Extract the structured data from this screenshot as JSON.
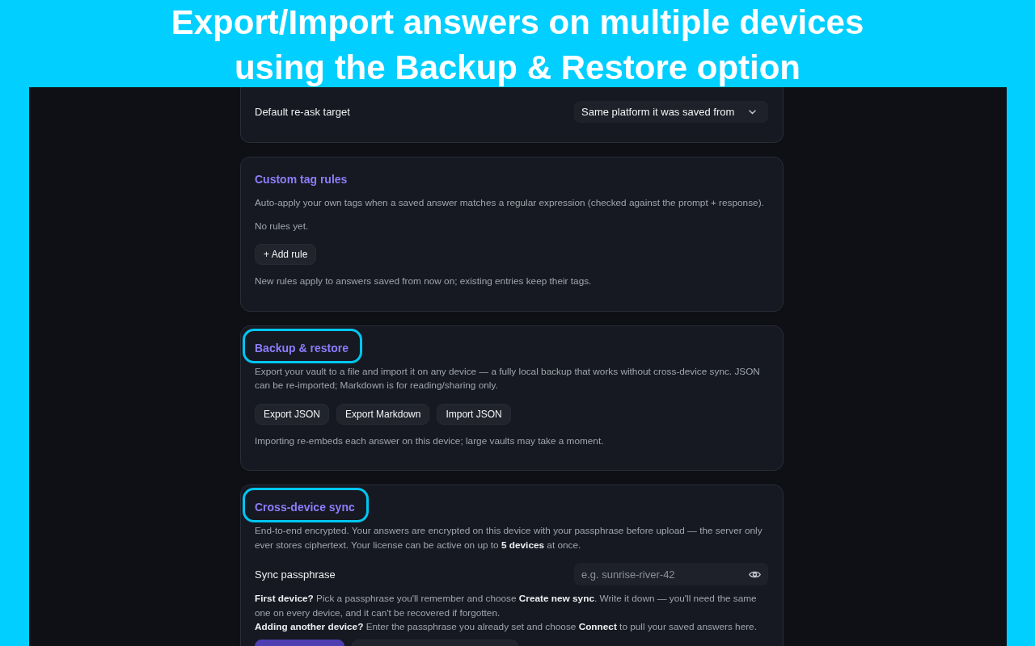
{
  "banner": {
    "lines": [
      "Export/Import answers on multiple devices",
      "using the Backup & Restore option"
    ]
  },
  "cards": [
    {
      "blocks": [
        {
          "kind": "select_row",
          "label": "Default re-ask target",
          "value": "Same platform it was saved from"
        }
      ]
    },
    {
      "title": "Custom tag rules",
      "highlighted": false,
      "blocks": [
        {
          "kind": "text",
          "paragraphs": [
            "Auto-apply your own tags when a saved answer matches a regular expression (checked against the prompt + response)."
          ]
        },
        {
          "kind": "text",
          "paragraphs": [
            "No rules yet."
          ]
        },
        {
          "kind": "buttons",
          "buttons": [
            {
              "kind": "secondary",
              "label": "+ Add rule"
            }
          ]
        },
        {
          "kind": "text",
          "paragraphs": [
            "New rules apply to answers saved from now on; existing entries keep their tags."
          ]
        }
      ]
    },
    {
      "title": "Backup & restore",
      "highlighted": true,
      "blocks": [
        {
          "kind": "text",
          "paragraphs": [
            "Export your vault to a file and import it on any device — a fully local backup that works without cross-device sync. JSON can be re-imported; Markdown is for reading/sharing only."
          ]
        },
        {
          "kind": "buttons",
          "buttons": [
            {
              "kind": "secondary",
              "label": "Export JSON"
            },
            {
              "kind": "secondary",
              "label": "Export Markdown"
            },
            {
              "kind": "secondary",
              "label": "Import JSON"
            }
          ]
        },
        {
          "kind": "text",
          "paragraphs": [
            "Importing re-embeds each answer on this device; large vaults may take a moment."
          ]
        }
      ]
    },
    {
      "title": "Cross-device sync",
      "highlighted": true,
      "blocks": [
        {
          "kind": "text",
          "paragraphs": [
            "End-to-end encrypted. Your answers are encrypted on this device with your passphrase before upload — the server only ever stores ciphertext. Your license can be active on up to **5 devices** at once."
          ]
        },
        {
          "kind": "input_row",
          "label": "Sync passphrase",
          "placeholder": "e.g. sunrise-river-42"
        },
        {
          "kind": "text",
          "paragraphs": [
            "**First device?** Pick a passphrase you'll remember and choose **Create new sync**. Write it down — you'll need the same one on every device, and it can't be recovered if forgotten.",
            "**Adding another device?** Enter the passphrase you already set and choose **Connect** to pull your saved answers here."
          ]
        },
        {
          "kind": "buttons",
          "buttons": [
            {
              "kind": "primary"
            },
            {
              "kind": "secondary"
            }
          ]
        }
      ]
    }
  ]
}
